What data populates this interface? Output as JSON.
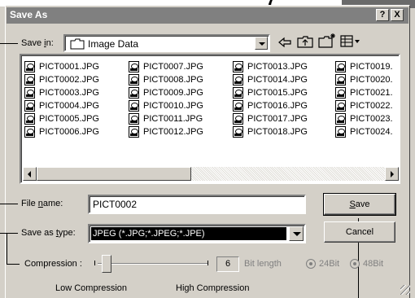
{
  "window": {
    "title": "Save As",
    "help_button": "?",
    "close_button": "X"
  },
  "save_in": {
    "label_before": "Save ",
    "label_underlined": "i",
    "label_after": "n:",
    "value": "Image Data"
  },
  "files": [
    [
      "PICT0001.JPG",
      "PICT0002.JPG",
      "PICT0003.JPG",
      "PICT0004.JPG",
      "PICT0005.JPG",
      "PICT0006.JPG"
    ],
    [
      "PICT0007.JPG",
      "PICT0008.JPG",
      "PICT0009.JPG",
      "PICT0010.JPG",
      "PICT0011.JPG",
      "PICT0012.JPG"
    ],
    [
      "PICT0013.JPG",
      "PICT0014.JPG",
      "PICT0015.JPG",
      "PICT0016.JPG",
      "PICT0017.JPG",
      "PICT0018.JPG"
    ],
    [
      "PICT0019.",
      "PICT0020.",
      "PICT0021.",
      "PICT0022.",
      "PICT0023.",
      "PICT0024."
    ]
  ],
  "file_name": {
    "label_before": "File ",
    "label_underlined": "n",
    "label_after": "ame:",
    "value": "PICT0002"
  },
  "save_as_type": {
    "label_before": "Save as ",
    "label_underlined": "t",
    "label_after": "ype:",
    "value": "JPEG (*.JPG;*.JPEG;*.JPE)"
  },
  "buttons": {
    "save_underlined": "S",
    "save_rest": "ave",
    "cancel": "Cancel"
  },
  "compression": {
    "label": "Compression :",
    "value": "6",
    "bit_length": "Bit length",
    "bit24": "24Bit",
    "bit48": "48Bit",
    "low": "Low Compression",
    "high": "High Compression"
  },
  "toolbar_icons": [
    "back-arrow-icon",
    "up-folder-icon",
    "new-folder-icon",
    "view-menu-icon"
  ],
  "colors": {
    "titlebar": "#808080",
    "face": "#d4d0c8",
    "selected": "#000000"
  }
}
